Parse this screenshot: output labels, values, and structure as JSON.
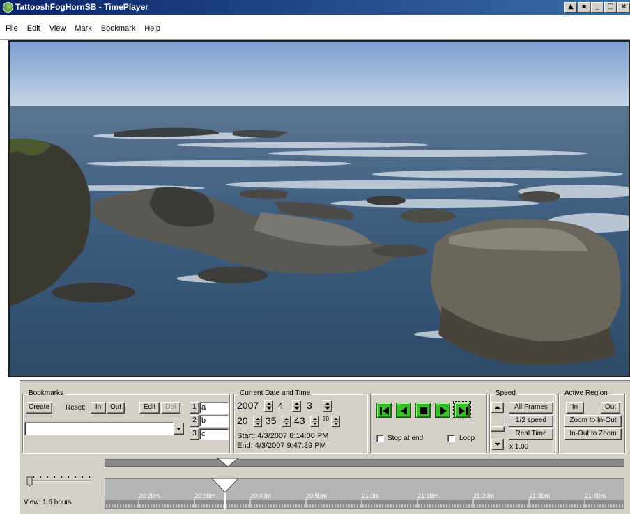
{
  "window": {
    "title": "TattooshFogHornSB - TimePlayer",
    "buttons": [
      "▲",
      "▪",
      "_",
      "□",
      "×"
    ]
  },
  "menu": [
    "File",
    "Edit",
    "View",
    "Mark",
    "Bookmark",
    "Help"
  ],
  "bookmarks": {
    "title": "Bookmarks",
    "create_label": "Create",
    "reset_label": "Reset:",
    "in_label": "In",
    "out_label": "Out",
    "edit_label": "Edit",
    "del_label": "Del",
    "dropdown_value": "",
    "slots": [
      {
        "num": "1",
        "value": "a"
      },
      {
        "num": "2",
        "value": "b"
      },
      {
        "num": "3",
        "value": "c"
      }
    ]
  },
  "datetime": {
    "title": "Current Date and Time",
    "year": "2007",
    "month": "4",
    "day": "3",
    "hour": "20",
    "minute": "35",
    "second": "43",
    "subsecond": "30",
    "start": "Start: 4/3/2007 8:14:00 PM",
    "end": "End: 4/3/2007 9:47:39 PM"
  },
  "transport": {
    "stop_at_end_label": "Stop at end",
    "loop_label": "Loop",
    "stop_at_end": false,
    "loop": false
  },
  "speed": {
    "title": "Speed",
    "all_frames": "All Frames",
    "half_speed": "1/2 speed",
    "real_time": "Real Time",
    "multiplier": "x 1.00"
  },
  "active_region": {
    "title": "Active Region",
    "in_label": "In",
    "out_label": "Out",
    "zoom_to_in_out": "Zoom to In-Out",
    "in_out_to_zoom": "In-Out to Zoom"
  },
  "timeline": {
    "view_label": "View: 1.6 hours",
    "ticks": [
      "20:20m",
      "20:30m",
      "20:40m",
      "20:50m",
      "21:0m",
      "21:10m",
      "21:20m",
      "21:30m",
      "21:40m"
    ],
    "playhead_time": "20:35:43"
  },
  "colors": {
    "titlebar": "#0a246a",
    "panel": "#d4d0c8",
    "transport_green": "#3cbf2c"
  }
}
